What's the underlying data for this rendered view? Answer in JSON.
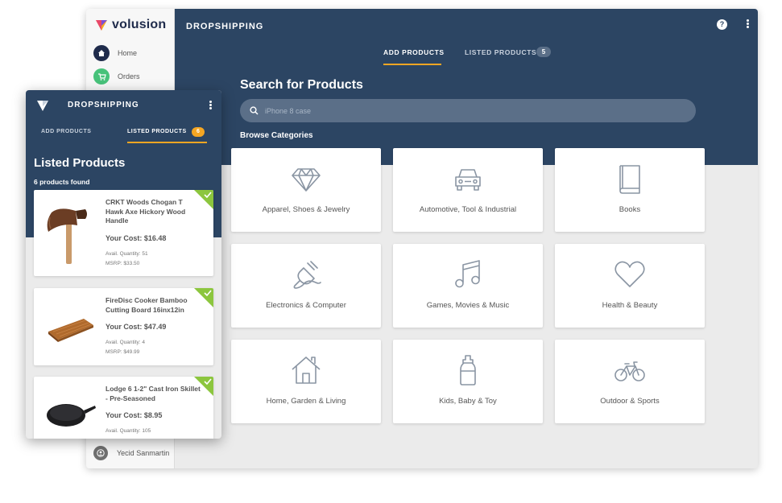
{
  "app": {
    "logo_text": "volusion",
    "sidebar": {
      "items": [
        {
          "label": "Home",
          "icon": "home-icon",
          "color": "#1f2b4b"
        },
        {
          "label": "Orders",
          "icon": "cart-icon",
          "color": "#47c27a"
        }
      ],
      "user_name": "Yecid Sanmartin"
    },
    "header": {
      "title": "DROPSHIPPING",
      "help_glyph": "?"
    },
    "tabs": [
      {
        "label": "ADD PRODUCTS",
        "active": true
      },
      {
        "label": "LISTED PRODUCTS",
        "count": "5",
        "active": false
      }
    ],
    "search": {
      "title": "Search for Products",
      "placeholder": "iPhone 8 case"
    },
    "browse_label": "Browse Categories",
    "categories": [
      {
        "label": "Apparel, Shoes & Jewelry",
        "icon": "diamond-icon"
      },
      {
        "label": "Automotive, Tool & Industrial",
        "icon": "car-icon"
      },
      {
        "label": "Books",
        "icon": "book-icon"
      },
      {
        "label": "Electronics & Computer",
        "icon": "plug-icon"
      },
      {
        "label": "Games, Movies & Music",
        "icon": "music-note-icon"
      },
      {
        "label": "Health & Beauty",
        "icon": "heart-icon"
      },
      {
        "label": "Home, Garden & Living",
        "icon": "house-icon"
      },
      {
        "label": "Kids, Baby & Toy",
        "icon": "baby-bottle-icon"
      },
      {
        "label": "Outdoor & Sports",
        "icon": "bicycle-icon"
      }
    ]
  },
  "phone": {
    "title": "DROPSHIPPING",
    "tabs": [
      {
        "label": "ADD PRODUCTS",
        "active": false
      },
      {
        "label": "LISTED PRODUCTS",
        "count": "6",
        "active": true
      }
    ],
    "heading": "Listed Products",
    "found_text": "6 products found",
    "products": [
      {
        "name": "CRKT Woods Chogan T Hawk Axe Hickory Wood Handle",
        "cost": "Your Cost: $16.48",
        "qty": "Avail. Quantity: 51",
        "msrp": "MSRP: $33.50",
        "thumb": "axe-icon"
      },
      {
        "name": "FireDisc Cooker Bamboo Cutting Board 16inx12in",
        "cost": "Your Cost: $47.49",
        "qty": "Avail. Quantity: 4",
        "msrp": "MSRP: $49.99",
        "thumb": "cutting-board-icon"
      },
      {
        "name": "Lodge 6 1-2\" Cast Iron Skillet - Pre-Seasoned",
        "cost": "Your Cost: $8.95",
        "qty": "Avail. Quantity: 105",
        "thumb": "skillet-icon"
      }
    ]
  },
  "colors": {
    "navy": "#2c4563",
    "accent": "#f5a623",
    "success": "#8cc63e"
  }
}
